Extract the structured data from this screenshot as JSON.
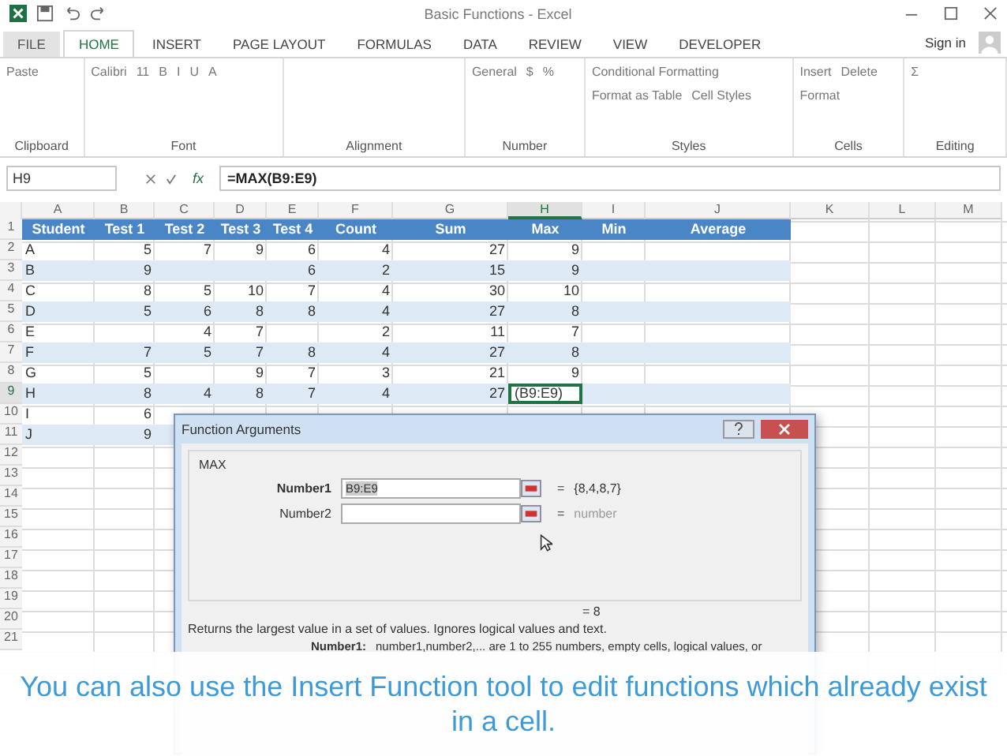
{
  "window": {
    "title": "Basic Functions - Excel"
  },
  "tabs": [
    {
      "label": "FILE",
      "selected": false
    },
    {
      "label": "HOME",
      "selected": true
    },
    {
      "label": "INSERT",
      "selected": false
    },
    {
      "label": "PAGE LAYOUT",
      "selected": false
    },
    {
      "label": "FORMULAS",
      "selected": false
    },
    {
      "label": "DATA",
      "selected": false
    },
    {
      "label": "REVIEW",
      "selected": false
    },
    {
      "label": "VIEW",
      "selected": false
    },
    {
      "label": "DEVELOPER",
      "selected": false
    }
  ],
  "sign_in": "Sign in",
  "ribbon_groups": [
    {
      "label": "Clipboard",
      "items": [
        "Paste"
      ]
    },
    {
      "label": "Font",
      "items": [
        "Calibri",
        "11",
        "B",
        "I",
        "U",
        "A"
      ]
    },
    {
      "label": "Alignment"
    },
    {
      "label": "Number",
      "items": [
        "General",
        "$",
        "%"
      ]
    },
    {
      "label": "Styles",
      "items": [
        "Conditional Formatting",
        "Format as Table",
        "Cell Styles"
      ]
    },
    {
      "label": "Cells",
      "items": [
        "Insert",
        "Delete",
        "Format"
      ]
    },
    {
      "label": "Editing",
      "items": [
        "Σ"
      ]
    }
  ],
  "formula_bar": {
    "name_box": "H9",
    "fx": "fx",
    "formula": "=MAX(B9:E9)"
  },
  "columns": [
    {
      "label": "A",
      "selected": false
    },
    {
      "label": "B",
      "selected": false
    },
    {
      "label": "C",
      "selected": false
    },
    {
      "label": "D",
      "selected": false
    },
    {
      "label": "E",
      "selected": false
    },
    {
      "label": "F",
      "selected": false
    },
    {
      "label": "G",
      "selected": false
    },
    {
      "label": "H",
      "selected": true
    },
    {
      "label": "I",
      "selected": false
    },
    {
      "label": "J",
      "selected": false
    },
    {
      "label": "K",
      "selected": false
    },
    {
      "label": "L",
      "selected": false
    },
    {
      "label": "M",
      "selected": false
    }
  ],
  "table_header": [
    "Student",
    "Test 1",
    "Test 2",
    "Test 3",
    "Test 4",
    "Count",
    "Sum",
    "Max",
    "Min",
    "Average"
  ],
  "rows": [
    {
      "num": "1",
      "selected": false,
      "cells": []
    },
    {
      "num": "2",
      "selected": false,
      "cells": [
        "A",
        "5",
        "7",
        "9",
        "6",
        "4",
        "27",
        "9"
      ]
    },
    {
      "num": "3",
      "selected": false,
      "cells": [
        "B",
        "9",
        null,
        null,
        "6",
        "2",
        "15",
        "9"
      ]
    },
    {
      "num": "4",
      "selected": false,
      "cells": [
        "C",
        "8",
        "5",
        "10",
        "7",
        "4",
        "30",
        "10"
      ]
    },
    {
      "num": "5",
      "selected": false,
      "cells": [
        "D",
        "5",
        "6",
        "8",
        "8",
        "4",
        "27",
        "8"
      ]
    },
    {
      "num": "6",
      "selected": false,
      "cells": [
        "E",
        null,
        "4",
        "7",
        null,
        "2",
        "11",
        "7"
      ]
    },
    {
      "num": "7",
      "selected": false,
      "cells": [
        "F",
        "7",
        "5",
        "7",
        "8",
        "4",
        "27",
        "8"
      ]
    },
    {
      "num": "8",
      "selected": false,
      "cells": [
        "G",
        "5",
        null,
        "9",
        "7",
        "3",
        "21",
        "9"
      ]
    },
    {
      "num": "9",
      "selected": true,
      "cells": [
        "H",
        "8",
        "4",
        "8",
        "7",
        "4",
        "27",
        "(B9:E9)"
      ]
    },
    {
      "num": "10",
      "selected": false,
      "cells": [
        "I",
        "6"
      ]
    },
    {
      "num": "11",
      "selected": false,
      "cells": [
        "J",
        "9"
      ]
    },
    {
      "num": "12",
      "selected": false,
      "cells": []
    },
    {
      "num": "13",
      "selected": false,
      "cells": []
    },
    {
      "num": "14",
      "selected": false,
      "cells": []
    },
    {
      "num": "15",
      "selected": false,
      "cells": []
    },
    {
      "num": "16",
      "selected": false,
      "cells": []
    },
    {
      "num": "17",
      "selected": false,
      "cells": []
    },
    {
      "num": "18",
      "selected": false,
      "cells": []
    },
    {
      "num": "19",
      "selected": false,
      "cells": []
    },
    {
      "num": "20",
      "selected": false,
      "cells": []
    },
    {
      "num": "21",
      "selected": false,
      "cells": []
    }
  ],
  "dialog": {
    "title": "Function Arguments",
    "function": "MAX",
    "args": [
      {
        "label": "Number1",
        "value": "B9:E9",
        "equals": "=",
        "result": "{8,4,8,7}",
        "selected": true
      },
      {
        "label": "Number2",
        "equals": "=",
        "result": "number",
        "selected": false
      }
    ],
    "result": "= 8",
    "description": "Returns the largest value in a set of values. Ignores logical values and text.",
    "arg_help_label": "Number1:",
    "arg_help": "number1,number2,...   are 1 to 255 numbers, empty cells, logical values, or"
  },
  "caption": "You can also use the Insert Function tool to edit functions which already exist in a cell."
}
